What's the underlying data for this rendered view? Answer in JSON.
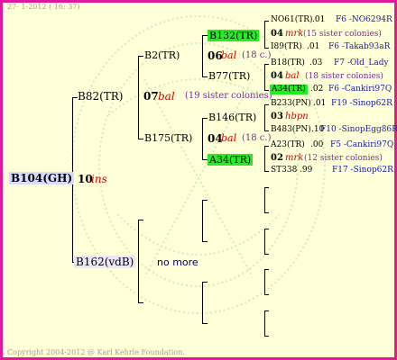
{
  "header": {
    "date": "27-  1-2012 ( 16: 37)"
  },
  "footer": {
    "copyright": "Copyright 2004-2012 @ Karl Kehrle Foundation."
  },
  "colors": {
    "border": "#e0189a",
    "background": "#ffffd8",
    "highlight": "#22ee22",
    "root_box": "#d8dcff",
    "mother_box": "#ece6fa",
    "tag": "#cc0000",
    "colonies": "#7a2ca0",
    "link": "#1818b0"
  },
  "root": {
    "name": "B104(GH)",
    "num": "10",
    "tag": "ins"
  },
  "father": {
    "name": "B82(TR)",
    "num": "07",
    "tag": "bal",
    "colonies": "(19 sister colonies)"
  },
  "mother": {
    "name": "B162(vdB)",
    "nomore": "no more"
  },
  "gf1": {
    "name": "B2(TR)",
    "num": "06",
    "tag": "bal",
    "colonies": "(18 c.)"
  },
  "gf2": {
    "name": "B175(TR)",
    "num": "04",
    "tag": "bal",
    "colonies": "(18 c.)"
  },
  "ggf1": {
    "name": "B132(TR)"
  },
  "ggm1": {
    "name": "B77(TR)"
  },
  "ggf2": {
    "name": "B146(TR)"
  },
  "ggm2": {
    "name": "A34(TR)"
  },
  "g4": [
    {
      "a_name": "NO61(TR)",
      "a_year": ".01",
      "a_link": "F6 -NO6294R",
      "num": "04",
      "tag": "mrk",
      "colonies": "(15 sister colonies)",
      "b_name": "I89(TR)",
      "b_year": ".01",
      "b_link": "F6 -Takab93aR"
    },
    {
      "a_name": "B18(TR)",
      "a_year": ".03",
      "a_link": "F7 -Old_Lady",
      "num": "04",
      "tag": "bal",
      "colonies": "(18 sister colonies)",
      "b_name": "A34(TR)",
      "b_year": ".02",
      "b_link": "F6 -Cankiri97Q"
    },
    {
      "a_name": "B233(PN)",
      "a_year": ".01",
      "a_link": "F19 -Sinop62R",
      "num": "03",
      "tag": "hbpn",
      "colonies": "",
      "b_name": "B483(PN)",
      "b_year": ".10",
      "b_link": "F10 -SinopEgg86R"
    },
    {
      "a_name": "A23(TR)",
      "a_year": ".00",
      "a_link": "F5 -Cankiri97Q",
      "num": "02",
      "tag": "mrk",
      "colonies": "(12 sister colonies)",
      "b_name": "ST338",
      "b_year": ".99",
      "b_link": "F17 -Sinop62R"
    }
  ]
}
